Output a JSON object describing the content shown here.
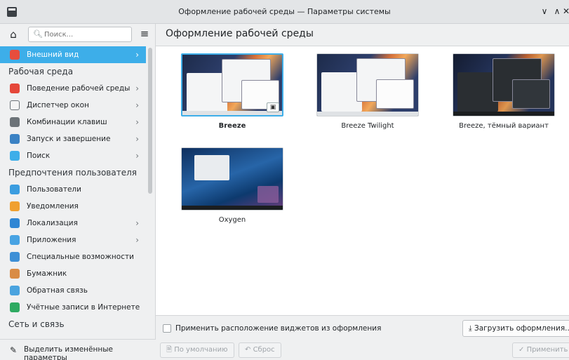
{
  "window": {
    "title": "Оформление рабочей среды — Параметры системы",
    "min_glyph": "∨",
    "max_glyph": "∧",
    "close_glyph": "✕"
  },
  "search": {
    "placeholder": "Поиск..."
  },
  "sidebar": {
    "selected": {
      "label": "Внешний вид",
      "icon": "appearance-icon",
      "color": "#e84d3d"
    },
    "sections": [
      {
        "title": "Рабочая среда",
        "items": [
          {
            "label": "Поведение рабочей среды",
            "icon": "workspace-behavior-icon",
            "color": "#e5473a",
            "chevron": true
          },
          {
            "label": "Диспетчер окон",
            "icon": "window-manager-icon",
            "color": "#f4f4f4",
            "chevron": true
          },
          {
            "label": "Комбинации клавиш",
            "icon": "keyboard-icon",
            "color": "#6c7378",
            "chevron": true
          },
          {
            "label": "Запуск и завершение",
            "icon": "startup-icon",
            "color": "#3b82c4",
            "chevron": true
          },
          {
            "label": "Поиск",
            "icon": "search-icon",
            "color": "#3daee9",
            "chevron": true
          }
        ]
      },
      {
        "title": "Предпочтения пользователя",
        "items": [
          {
            "label": "Пользователи",
            "icon": "users-icon",
            "color": "#3b9de0",
            "chevron": false
          },
          {
            "label": "Уведомления",
            "icon": "bell-icon",
            "color": "#f0a030",
            "chevron": false
          },
          {
            "label": "Локализация",
            "icon": "locale-icon",
            "color": "#2f86d4",
            "chevron": true
          },
          {
            "label": "Приложения",
            "icon": "apps-icon",
            "color": "#47a3e3",
            "chevron": true
          },
          {
            "label": "Специальные возможности",
            "icon": "accessibility-icon",
            "color": "#3d8fd6",
            "chevron": false
          },
          {
            "label": "Бумажник",
            "icon": "wallet-icon",
            "color": "#d98c45",
            "chevron": false
          },
          {
            "label": "Обратная связь",
            "icon": "feedback-icon",
            "color": "#4aa3df",
            "chevron": false
          },
          {
            "label": "Учётные записи в Интернете",
            "icon": "online-accounts-icon",
            "color": "#2eaa62",
            "chevron": false
          }
        ]
      },
      {
        "title": "Сеть и связь",
        "items": []
      }
    ],
    "highlight_changed": "Выделить изменённые параметры"
  },
  "main": {
    "title": "Оформление рабочей среды",
    "themes": [
      {
        "name": "Breeze",
        "selected": true,
        "wallpaper": "breeze"
      },
      {
        "name": "Breeze Twilight",
        "selected": false,
        "wallpaper": "breeze"
      },
      {
        "name": "Breeze, тёмный вариант",
        "selected": false,
        "wallpaper": "dark"
      },
      {
        "name": "Oxygen",
        "selected": false,
        "wallpaper": "oxygen"
      }
    ],
    "apply_layout_label": "Применить расположение виджетов из оформления",
    "apply_layout_checked": false,
    "download_label": "Загрузить оформления...",
    "defaults_label": "По умолчанию",
    "reset_label": "Сброс",
    "apply_label": "Применить"
  },
  "colors": {
    "accent": "#3daee9"
  }
}
